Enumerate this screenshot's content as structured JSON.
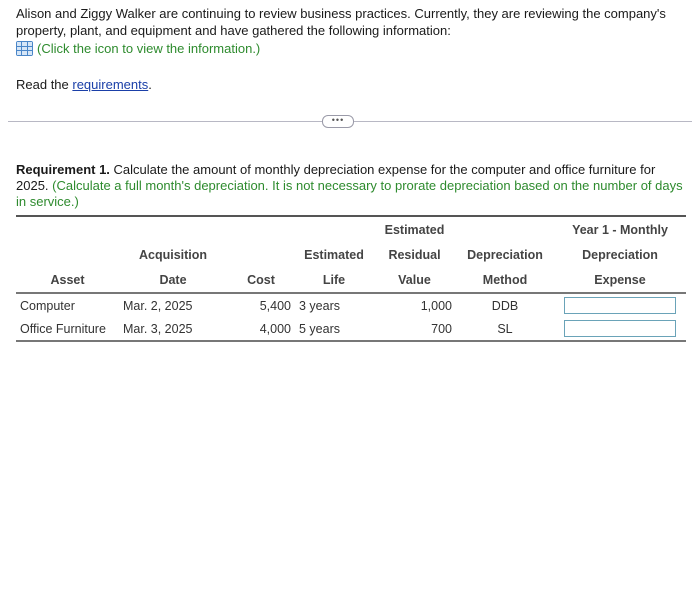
{
  "intro": {
    "text": "Alison and Ziggy Walker are continuing to review business practices. Currently, they are reviewing the company's property, plant, and equipment and have gathered the following information:",
    "info_icon": "table-grid-icon",
    "info_link": "(Click the icon to view the information.)",
    "read_prefix": "Read the ",
    "read_link": "requirements",
    "read_suffix": "."
  },
  "separator": {
    "expand_label": "•••"
  },
  "requirement": {
    "label": "Requirement 1.",
    "text": " Calculate the amount of monthly depreciation expense for the computer and office furniture for 2025. ",
    "note": "(Calculate a full month's depreciation. It is not necessary to prorate depreciation based on the number of days in service.)"
  },
  "table": {
    "headers": {
      "row1": [
        "",
        "",
        "",
        "",
        "Estimated",
        "",
        "Year 1 - Monthly"
      ],
      "row2": [
        "",
        "Acquisition",
        "",
        "Estimated",
        "Residual",
        "Depreciation",
        "Depreciation"
      ],
      "row3": [
        "Asset",
        "Date",
        "Cost",
        "Life",
        "Value",
        "Method",
        "Expense"
      ]
    },
    "rows": [
      {
        "asset": "Computer",
        "date": "Mar. 2, 2025",
        "cost": "5,400",
        "life": "3 years",
        "residual": "1,000",
        "method": "DDB",
        "expense": ""
      },
      {
        "asset": "Office Furniture",
        "date": "Mar. 3, 2025",
        "cost": "4,000",
        "life": "5 years",
        "residual": "700",
        "method": "SL",
        "expense": ""
      }
    ]
  },
  "colors": {
    "green_note": "#2e8b2e",
    "link": "#1a3fa8",
    "icon": "#4a86c8",
    "input_border": "#6aa3b8"
  }
}
